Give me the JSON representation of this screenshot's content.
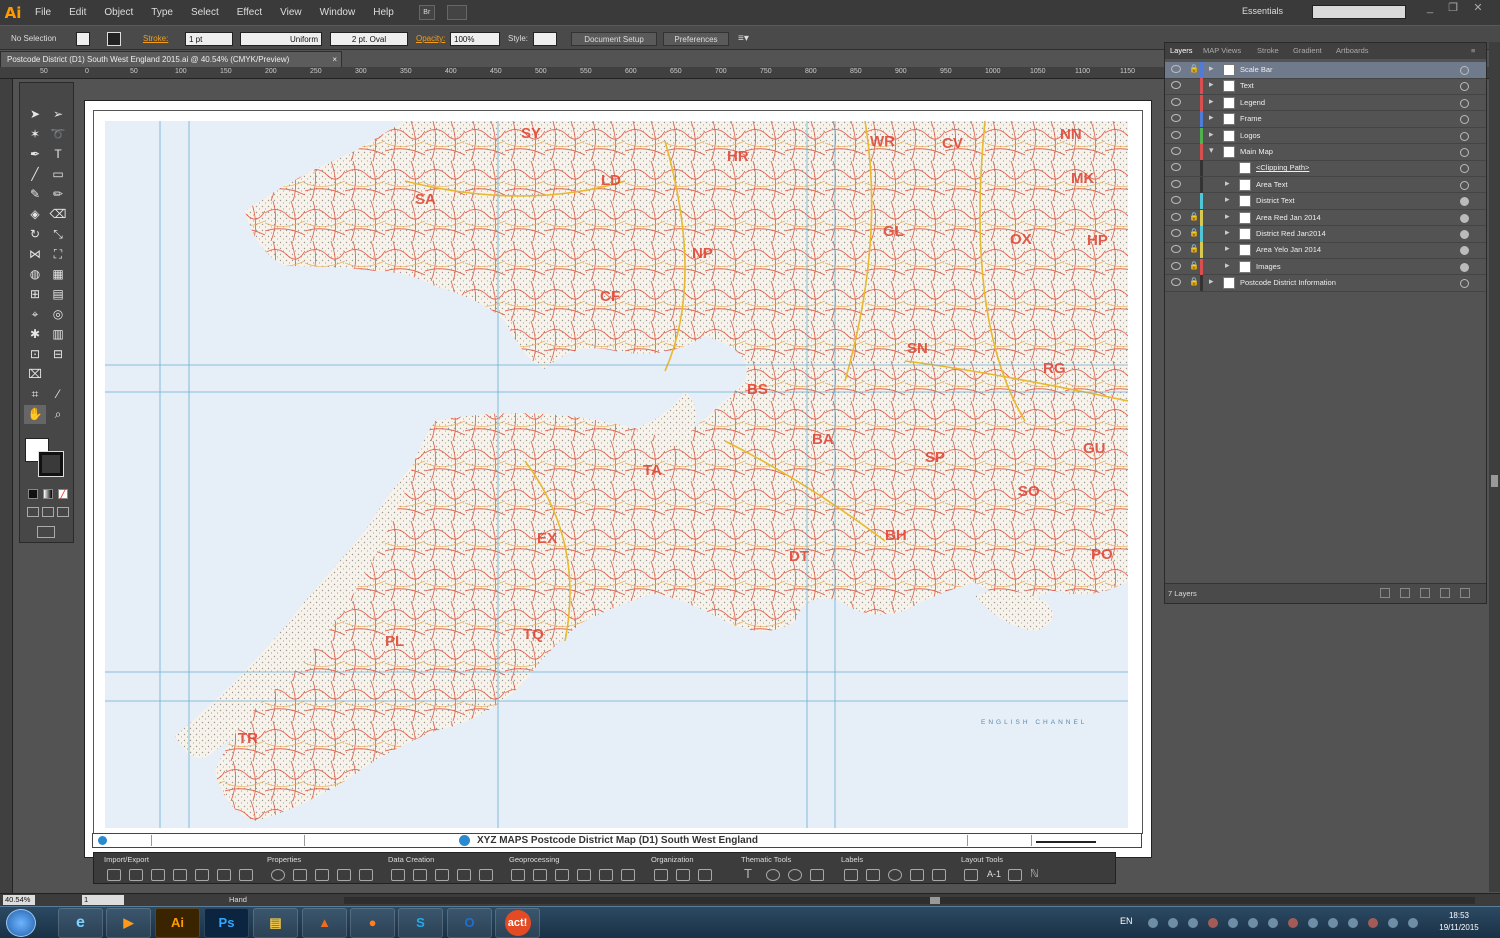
{
  "app": {
    "logo": "Ai",
    "menus": [
      "File",
      "Edit",
      "Object",
      "Type",
      "Select",
      "Effect",
      "View",
      "Window",
      "Help"
    ],
    "workspace": "Essentials",
    "bridge_label": "Br"
  },
  "control_bar": {
    "selection": "No Selection",
    "stroke_label": "Stroke:",
    "stroke_weight": "1 pt",
    "stroke_style": "Uniform",
    "brush": "2 pt. Oval",
    "opacity_label": "Opacity:",
    "opacity": "100%",
    "style_label": "Style:",
    "document_setup": "Document Setup",
    "preferences": "Preferences"
  },
  "document": {
    "tab_title": "Postcode District (D1) South West England 2015.ai @ 40.54% (CMYK/Preview)",
    "zoom": "40.54%",
    "artboard_number": "1",
    "status_tool": "Hand"
  },
  "ruler": {
    "h_ticks": [
      "50",
      "0",
      "50",
      "100",
      "150",
      "200",
      "250",
      "300",
      "350",
      "400",
      "450",
      "500",
      "550",
      "600",
      "650",
      "700",
      "750",
      "800",
      "850",
      "900",
      "950",
      "1000",
      "1050",
      "1100",
      "1150"
    ]
  },
  "map": {
    "title": "XYZ MAPS  Postcode District Map  (D1)  South West England",
    "sea_label": "ENGLISH CHANNEL",
    "area_codes": [
      "SY",
      "HR",
      "WR",
      "CV",
      "NN",
      "LD",
      "MK",
      "SA",
      "GL",
      "NP",
      "OX",
      "HP",
      "CF",
      "SN",
      "BS",
      "RG",
      "BA",
      "GU",
      "TA",
      "SP",
      "SO",
      "EX",
      "DT",
      "BH",
      "PO",
      "PL",
      "TQ",
      "TR"
    ]
  },
  "xyz_toolbar": {
    "sections": [
      "Import/Export",
      "Properties",
      "Data Creation",
      "Geoprocessing",
      "Organization",
      "Thematic Tools",
      "Labels",
      "Layout Tools"
    ],
    "layout_text": "A-1"
  },
  "layers_panel": {
    "tabs": [
      "Layers",
      "MAP Views",
      "Stroke",
      "Gradient",
      "Artboards"
    ],
    "count": "7 Layers",
    "layers": [
      {
        "name": "Scale Bar",
        "color": "#4f7bd9",
        "selected": true,
        "level": 0,
        "locked": true,
        "filled": false
      },
      {
        "name": "Text",
        "color": "#d94f4f",
        "selected": false,
        "level": 0,
        "locked": false,
        "filled": false
      },
      {
        "name": "Legend",
        "color": "#d94f4f",
        "selected": false,
        "level": 0,
        "locked": false,
        "filled": false
      },
      {
        "name": "Frame",
        "color": "#4f7bd9",
        "selected": false,
        "level": 0,
        "locked": false,
        "filled": false
      },
      {
        "name": "Logos",
        "color": "#4fb24f",
        "selected": false,
        "level": 0,
        "locked": false,
        "filled": false
      },
      {
        "name": "Main Map",
        "color": "#d94f4f",
        "selected": false,
        "level": 0,
        "locked": false,
        "filled": false,
        "expanded": true
      },
      {
        "name": "<Clipping Path>",
        "color": "#333333",
        "selected": false,
        "level": 1,
        "locked": false,
        "filled": false
      },
      {
        "name": "Area Text",
        "color": "#333333",
        "selected": false,
        "level": 1,
        "locked": false,
        "filled": false
      },
      {
        "name": "District Text",
        "color": "#4fc7d9",
        "selected": false,
        "level": 1,
        "locked": false,
        "filled": true
      },
      {
        "name": "Area Red Jan 2014",
        "color": "#d9c84f",
        "selected": false,
        "level": 1,
        "locked": true,
        "filled": true
      },
      {
        "name": "District Red Jan2014",
        "color": "#4fc7d9",
        "selected": false,
        "level": 1,
        "locked": true,
        "filled": true
      },
      {
        "name": "Area Yelo Jan 2014",
        "color": "#d9c84f",
        "selected": false,
        "level": 1,
        "locked": true,
        "filled": true
      },
      {
        "name": "Images",
        "color": "#d94f4f",
        "selected": false,
        "level": 1,
        "locked": true,
        "filled": true
      },
      {
        "name": "Postcode District Information",
        "color": "#333333",
        "selected": false,
        "level": 0,
        "locked": true,
        "filled": false
      }
    ]
  },
  "taskbar": {
    "language": "EN",
    "time": "18:53",
    "date": "19/11/2015",
    "apps": [
      "Ai",
      "Ps",
      "act!"
    ]
  }
}
